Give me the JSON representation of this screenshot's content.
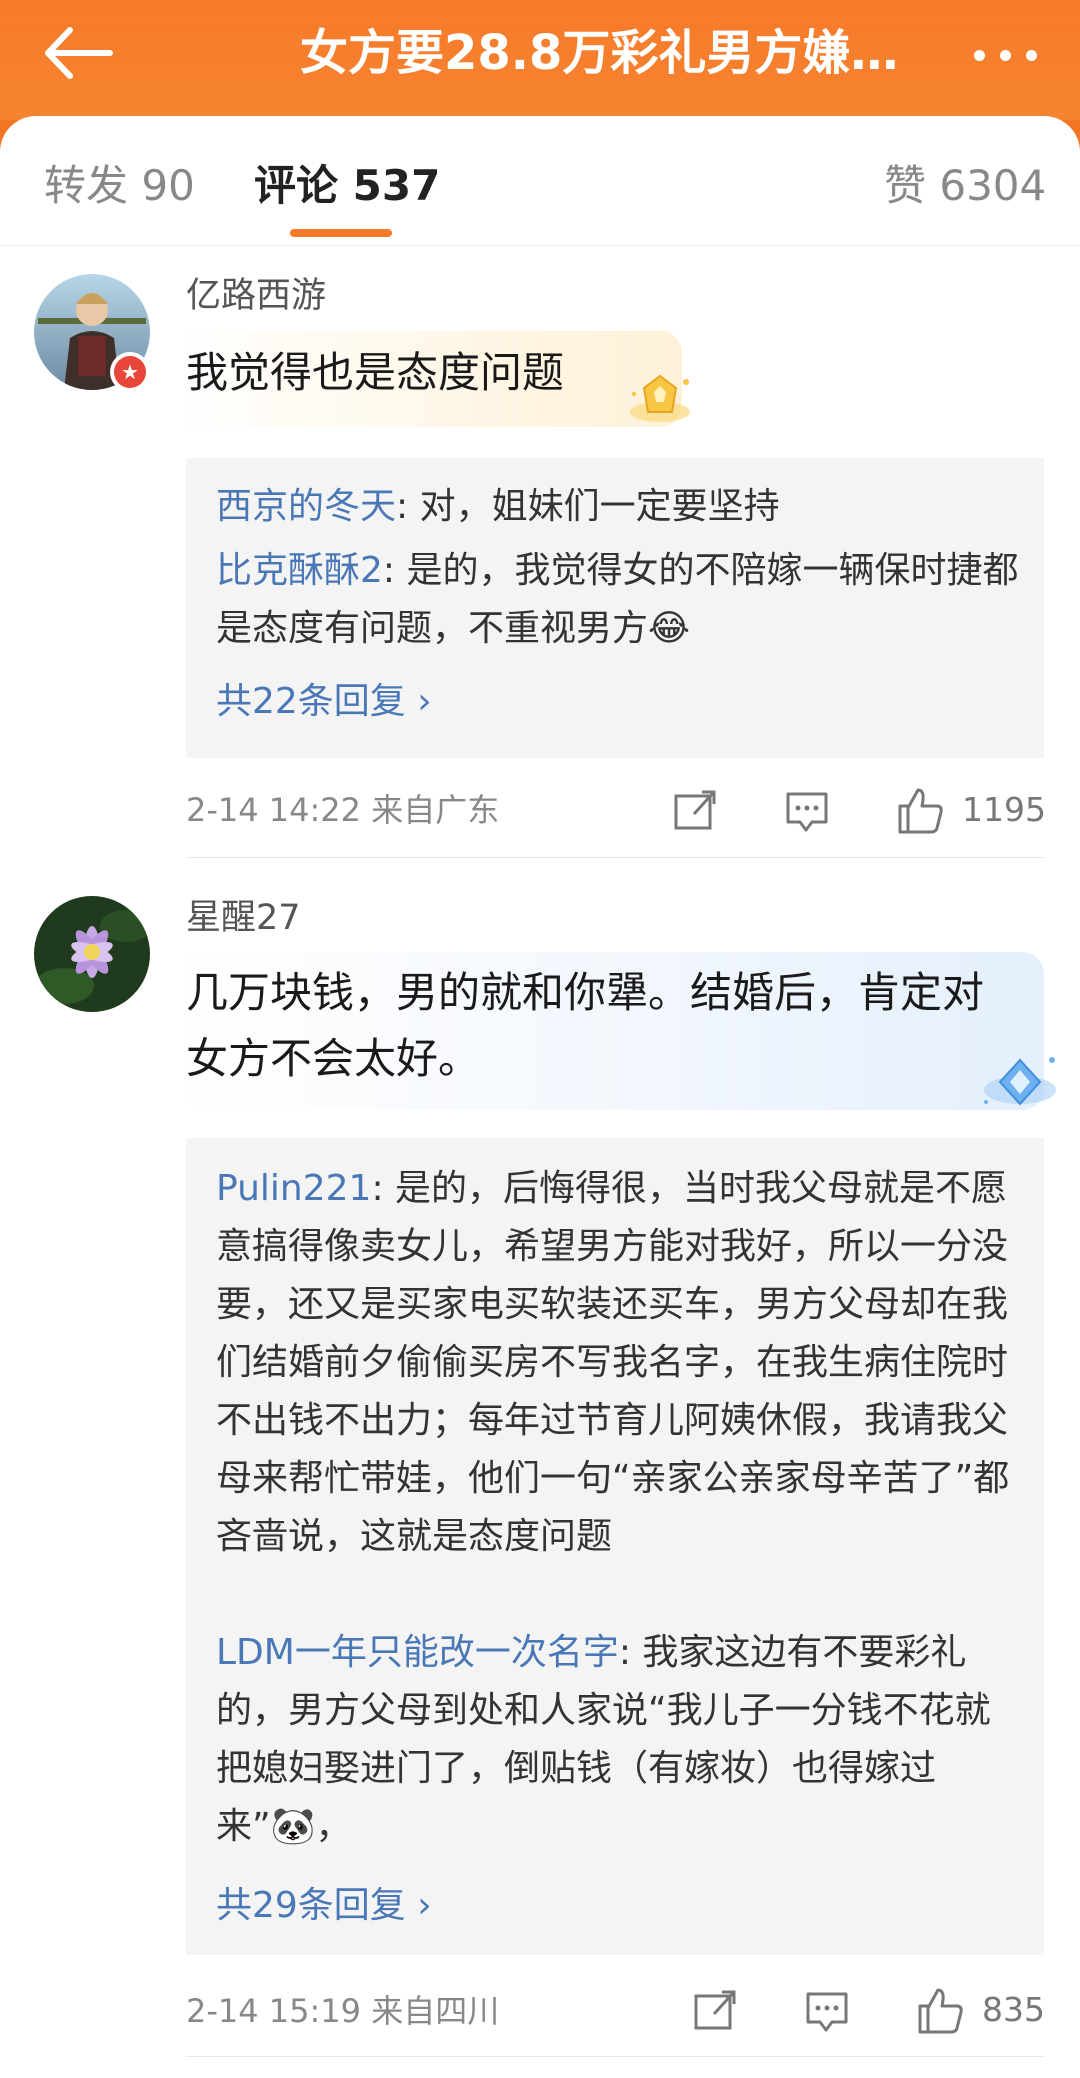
{
  "header": {
    "title": "女方要28.8万彩礼男方嫌…",
    "accent_color": "#f77a2a",
    "back_icon": "back-arrow-icon",
    "more_icon": "more-dots-icon"
  },
  "tabs": {
    "repost": "转发 90",
    "comments": "评论 537",
    "likes": "赞 6304"
  },
  "comments": [
    {
      "username": "亿路西游",
      "text": "我觉得也是态度问题",
      "badge": "gold-crown-badge",
      "replies": [
        {
          "name": "西京的冬天",
          "text": ": 对，姐妹们一定要坚持"
        },
        {
          "name": "比克酥酥2",
          "text": ": 是的，我觉得女的不陪嫁一辆保时捷都是态度有问题，不重视男方😂"
        }
      ],
      "more_replies": "共22条回复 ›",
      "time_location": "2-14 14:22  来自广东",
      "like_count": "1195"
    },
    {
      "username": "星醒27",
      "text": "几万块钱，男的就和你犟。结婚后，肯定对女方不会太好。",
      "badge": "blue-diamond-badge",
      "replies": [
        {
          "name": "Pulin221",
          "text": ": 是的，后悔得很，当时我父母就是不愿意搞得像卖女儿，希望男方能对我好，所以一分没要，还又是买家电买软装还买车，男方父母却在我们结婚前夕偷偷买房不写我名字，在我生病住院时不出钱不出力；每年过节育儿阿姨休假，我请我父母来帮忙带娃，他们一句“亲家公亲家母辛苦了”都吝啬说，这就是态度问题"
        },
        {
          "name": "LDM一年只能改一次名字",
          "text": ": 我家这边有不要彩礼的，男方父母到处和人家说“我儿子一分钱不花就把媳妇娶进门了，倒贴钱（有嫁妆）也得嫁过来”🐼，"
        }
      ],
      "more_replies": "共29条回复 ›",
      "time_location": "2-14 15:19  来自四川",
      "like_count": "835"
    }
  ]
}
